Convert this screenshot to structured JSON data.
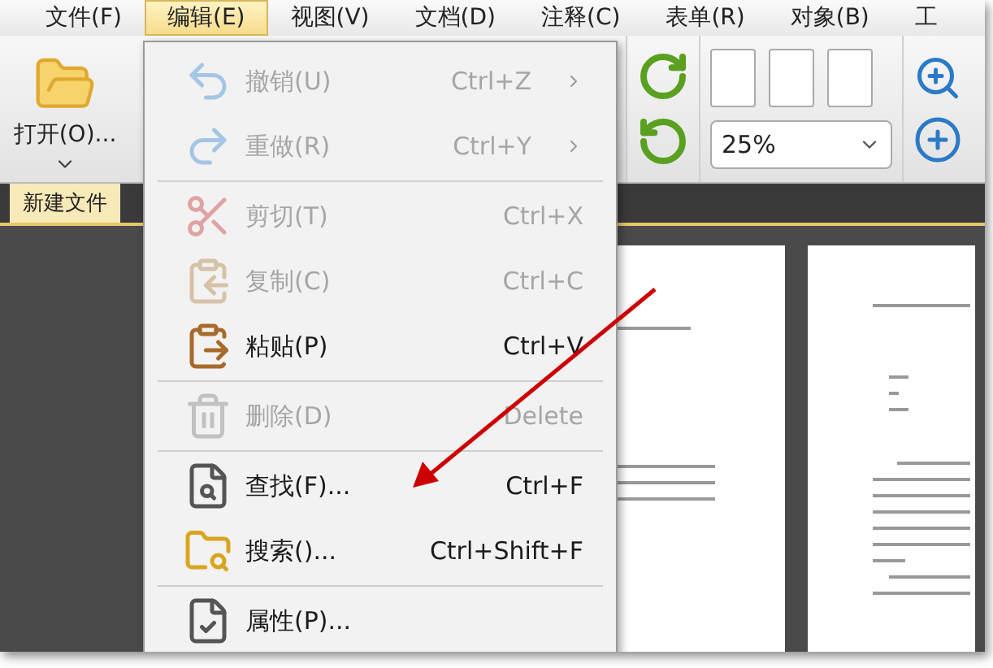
{
  "menubar": [
    {
      "label": "文件(F)",
      "selected": false
    },
    {
      "label": "编辑(E)",
      "selected": true
    },
    {
      "label": "视图(V)",
      "selected": false
    },
    {
      "label": "文档(D)",
      "selected": false
    },
    {
      "label": "注释(C)",
      "selected": false
    },
    {
      "label": "表单(R)",
      "selected": false
    },
    {
      "label": "对象(B)",
      "selected": false
    },
    {
      "label": "工",
      "selected": false
    }
  ],
  "toolbar": {
    "open_button": "打开(O)...",
    "zoom_select": {
      "value": "25%"
    }
  },
  "tabs": [
    {
      "label": "新建文件",
      "selected": true
    }
  ],
  "edit_menu": [
    {
      "kind": "item",
      "label": "撤销(U)",
      "shortcut": "Ctrl+Z",
      "disabled": true,
      "submenu": true
    },
    {
      "kind": "item",
      "label": "重做(R)",
      "shortcut": "Ctrl+Y",
      "disabled": true,
      "submenu": true
    },
    {
      "kind": "separator"
    },
    {
      "kind": "item",
      "label": "剪切(T)",
      "shortcut": "Ctrl+X",
      "disabled": true,
      "submenu": false
    },
    {
      "kind": "item",
      "label": "复制(C)",
      "shortcut": "Ctrl+C",
      "disabled": true,
      "submenu": false
    },
    {
      "kind": "item",
      "label": "粘贴(P)",
      "shortcut": "Ctrl+V",
      "disabled": false,
      "submenu": false
    },
    {
      "kind": "separator"
    },
    {
      "kind": "item",
      "label": "删除(D)",
      "shortcut": "Delete",
      "disabled": true,
      "submenu": false
    },
    {
      "kind": "separator"
    },
    {
      "kind": "item",
      "label": "查找(F)...",
      "shortcut": "Ctrl+F",
      "disabled": false,
      "submenu": false
    },
    {
      "kind": "item",
      "label": "搜索()...",
      "shortcut": "Ctrl+Shift+F",
      "disabled": false,
      "submenu": false
    },
    {
      "kind": "separator"
    },
    {
      "kind": "item",
      "label": "属性(P)...",
      "disabled": false,
      "submenu": false
    }
  ]
}
